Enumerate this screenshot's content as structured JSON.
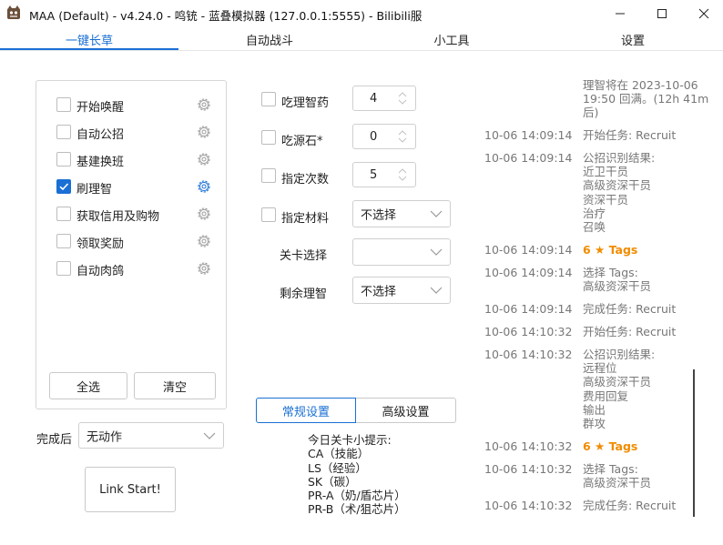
{
  "window": {
    "title": "MAA (Default) - v4.24.0 - 鸣铳 - 蓝叠模拟器 (127.0.0.1:5555) - Bilibili服"
  },
  "tabs": [
    "一键长草",
    "自动战斗",
    "小工具",
    "设置"
  ],
  "tasks": [
    {
      "label": "开始唤醒",
      "checked": false
    },
    {
      "label": "自动公招",
      "checked": false
    },
    {
      "label": "基建换班",
      "checked": false
    },
    {
      "label": "刷理智",
      "checked": true
    },
    {
      "label": "获取信用及购物",
      "checked": false
    },
    {
      "label": "领取奖励",
      "checked": false
    },
    {
      "label": "自动肉鸽",
      "checked": false
    }
  ],
  "task_buttons": {
    "select_all": "全选",
    "clear": "清空"
  },
  "after_completion": {
    "label": "完成后",
    "value": "无动作"
  },
  "link_start": "Link Start!",
  "settings": {
    "medicine": {
      "label": "吃理智药",
      "value": "4",
      "checked": false
    },
    "stone": {
      "label": "吃源石*",
      "value": "0",
      "checked": false
    },
    "times": {
      "label": "指定次数",
      "value": "5",
      "checked": false
    },
    "material": {
      "label": "指定材料",
      "value": "不选择",
      "checked": false
    },
    "stage": {
      "label": "关卡选择",
      "value": ""
    },
    "remaining": {
      "label": "剩余理智",
      "value": "不选择"
    }
  },
  "settings_tabs": {
    "normal": "常规设置",
    "advanced": "高级设置"
  },
  "tips": {
    "heading": "今日关卡小提示:",
    "lines": [
      "CA（技能）",
      "LS（经验）",
      "SK（碳）",
      "PR-A（奶/盾芯片）",
      "PR-B（术/狙芯片）"
    ]
  },
  "log": {
    "sanity_notice": [
      "理智将在 2023-10-06",
      "19:50 回满。(12h 41m",
      "后)"
    ],
    "entries": [
      {
        "time": "10-06  14:09:14",
        "lines": [
          "开始任务: Recruit"
        ],
        "color": "gray"
      },
      {
        "time": "10-06  14:09:14",
        "lines": [
          "公招识别结果:",
          "近卫干员",
          "高级资深干员",
          "资深干员",
          "治疗",
          "召唤"
        ],
        "color": "gray"
      },
      {
        "time": "10-06  14:09:14",
        "lines": [
          "6 ★ Tags"
        ],
        "color": "orange"
      },
      {
        "time": "10-06  14:09:14",
        "lines": [
          "选择 Tags:",
          "高级资深干员"
        ],
        "color": "gray"
      },
      {
        "time": "10-06  14:09:14",
        "lines": [
          "完成任务: Recruit"
        ],
        "color": "gray"
      },
      {
        "time": "10-06  14:10:32",
        "lines": [
          "开始任务: Recruit"
        ],
        "color": "gray"
      },
      {
        "time": "10-06  14:10:32",
        "lines": [
          "公招识别结果:",
          "远程位",
          "高级资深干员",
          "费用回复",
          "输出",
          "群攻"
        ],
        "color": "gray"
      },
      {
        "time": "10-06  14:10:32",
        "lines": [
          "6 ★ Tags"
        ],
        "color": "orange"
      },
      {
        "time": "10-06  14:10:32",
        "lines": [
          "选择 Tags:",
          "高级资深干员"
        ],
        "color": "gray"
      },
      {
        "time": "10-06  14:10:32",
        "lines": [
          "完成任务: Recruit"
        ],
        "color": "gray"
      }
    ]
  },
  "colors": {
    "accent": "#1a6fd4",
    "orange": "#f08c00",
    "log_gray": "#777777"
  }
}
